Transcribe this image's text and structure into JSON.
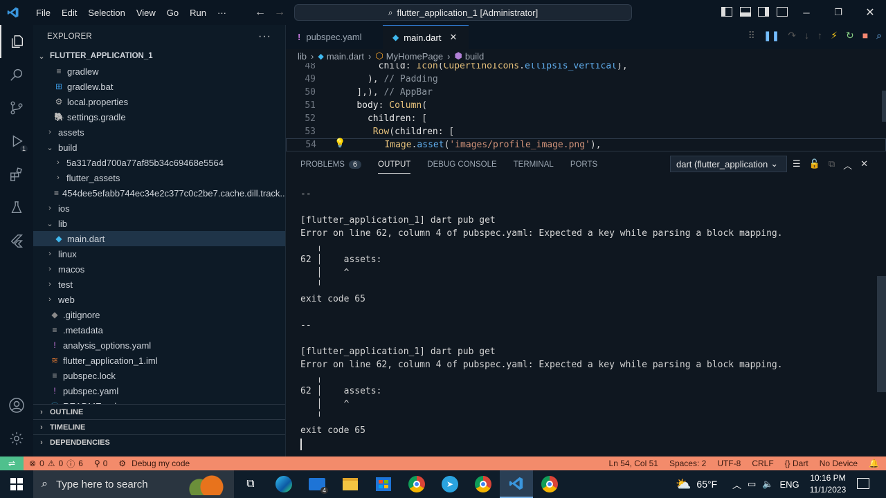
{
  "titlebar": {
    "menu": [
      "File",
      "Edit",
      "Selection",
      "View",
      "Go",
      "Run",
      "···"
    ],
    "title": "flutter_application_1 [Administrator]"
  },
  "explorer": {
    "header": "EXPLORER",
    "project": "FLUTTER_APPLICATION_1",
    "items": [
      {
        "label": "gradlew",
        "indent": 1,
        "type": "file",
        "icon": "file"
      },
      {
        "label": "gradlew.bat",
        "indent": 1,
        "type": "file",
        "icon": "windows"
      },
      {
        "label": "local.properties",
        "indent": 1,
        "type": "file",
        "icon": "gear"
      },
      {
        "label": "settings.gradle",
        "indent": 1,
        "type": "file",
        "icon": "gradle"
      },
      {
        "label": "assets",
        "indent": 0,
        "type": "folder",
        "open": false
      },
      {
        "label": "build",
        "indent": 0,
        "type": "folder",
        "open": true
      },
      {
        "label": "5a317add700a77af85b34c69468e5564",
        "indent": 1,
        "type": "folder",
        "open": false
      },
      {
        "label": "flutter_assets",
        "indent": 1,
        "type": "folder",
        "open": false
      },
      {
        "label": "454dee5efabb744ec34e2c377c0c2be7.cache.dill.track....",
        "indent": 1,
        "type": "file",
        "icon": "file"
      },
      {
        "label": "ios",
        "indent": 0,
        "type": "folder",
        "open": false
      },
      {
        "label": "lib",
        "indent": 0,
        "type": "folder",
        "open": true
      },
      {
        "label": "main.dart",
        "indent": 1,
        "type": "file",
        "icon": "dart",
        "selected": true
      },
      {
        "label": "linux",
        "indent": 0,
        "type": "folder",
        "open": false
      },
      {
        "label": "macos",
        "indent": 0,
        "type": "folder",
        "open": false
      },
      {
        "label": "test",
        "indent": 0,
        "type": "folder",
        "open": false
      },
      {
        "label": "web",
        "indent": 0,
        "type": "folder",
        "open": false
      },
      {
        "label": ".gitignore",
        "indent": 0,
        "type": "file",
        "icon": "git"
      },
      {
        "label": ".metadata",
        "indent": 0,
        "type": "file",
        "icon": "lines"
      },
      {
        "label": "analysis_options.yaml",
        "indent": 0,
        "type": "file",
        "icon": "yaml"
      },
      {
        "label": "flutter_application_1.iml",
        "indent": 0,
        "type": "file",
        "icon": "rss"
      },
      {
        "label": "pubspec.lock",
        "indent": 0,
        "type": "file",
        "icon": "lines"
      },
      {
        "label": "pubspec.yaml",
        "indent": 0,
        "type": "file",
        "icon": "yaml"
      },
      {
        "label": "README.md",
        "indent": 0,
        "type": "file",
        "icon": "info"
      }
    ],
    "sections": [
      "OUTLINE",
      "TIMELINE",
      "DEPENDENCIES"
    ]
  },
  "tabs": [
    {
      "label": "pubspec.yaml",
      "icon": "!",
      "active": false
    },
    {
      "label": "main.dart",
      "icon": "dart",
      "active": true
    }
  ],
  "breadcrumb": [
    "lib",
    "main.dart",
    "MyHomePage",
    "build"
  ],
  "editor": {
    "lines": [
      {
        "n": "48",
        "text": "        child: Icon(CupertinoIcons.ellipsis_vertical),"
      },
      {
        "n": "49",
        "text": "      ), // Padding"
      },
      {
        "n": "50",
        "text": "    ],), // AppBar"
      },
      {
        "n": "51",
        "text": "    body: Column("
      },
      {
        "n": "52",
        "text": "      children: ["
      },
      {
        "n": "53",
        "text": "       Row(children: ["
      },
      {
        "n": "54",
        "text": "         Image.asset('images/profile_image.png'),"
      }
    ]
  },
  "panel": {
    "tabs": [
      "PROBLEMS",
      "OUTPUT",
      "DEBUG CONSOLE",
      "TERMINAL",
      "PORTS"
    ],
    "problems_count": "6",
    "active": "OUTPUT",
    "channel": "dart (flutter_application",
    "output": [
      "--",
      "",
      "[flutter_application_1] dart pub get",
      "Error on line 62, column 4 of pubspec.yaml: Expected a key while parsing a block mapping.",
      "   ╷",
      "62 │    assets:",
      "   │    ^",
      "   ╵",
      "exit code 65",
      "",
      "--",
      "",
      "[flutter_application_1] dart pub get",
      "Error on line 62, column 4 of pubspec.yaml: Expected a key while parsing a block mapping.",
      "   ╷",
      "62 │    assets:",
      "   │    ^",
      "   ╵",
      "exit code 65"
    ]
  },
  "statusbar": {
    "errors": "0",
    "warnings": "0",
    "infos": "6",
    "ports": "0",
    "debug": "Debug my code",
    "position": "Ln 54, Col 51",
    "spaces": "Spaces: 2",
    "encoding": "UTF-8",
    "eol": "CRLF",
    "language": "Dart",
    "device": "No Device"
  },
  "taskbar": {
    "search_placeholder": "Type here to search",
    "weather": "65°F",
    "lang": "ENG",
    "time": "10:16 PM",
    "date": "11/1/2023",
    "mail_badge": "4"
  },
  "colors": {
    "status_bg": "#f38b6b",
    "accent": "#3794ff",
    "keyword": "#e5c07b",
    "string": "#ce9178"
  }
}
